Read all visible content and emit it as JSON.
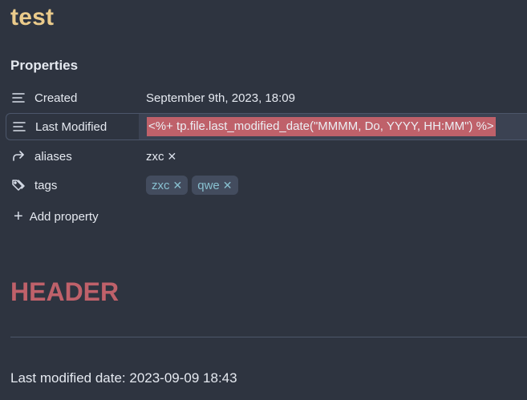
{
  "note": {
    "title": "test"
  },
  "properties": {
    "heading": "Properties",
    "rows": [
      {
        "key": "Created",
        "icon": "text-lines-icon",
        "value": "September 9th, 2023, 18:09"
      },
      {
        "key": "Last Modified",
        "icon": "text-lines-icon",
        "value": "<%+ tp.file.last_modified_date(\"MMMM, Do, YYYY, HH:MM\") %>"
      },
      {
        "key": "aliases",
        "icon": "forward-arrow-icon",
        "items": [
          "zxc"
        ]
      },
      {
        "key": "tags",
        "icon": "tags-icon",
        "items": [
          "zxc",
          "qwe"
        ]
      }
    ],
    "remove_symbol": "✕",
    "add_label": "Add property",
    "add_symbol": "+"
  },
  "body": {
    "header": "HEADER",
    "last_modified_line": "Last modified date: 2023-09-09 18:43"
  },
  "colors": {
    "background": "#2e3440",
    "title": "#ebcb8b",
    "header": "#bf616a",
    "selection": "#bf616a",
    "tag_text": "#88c0d0",
    "tag_bg": "#434c5e"
  }
}
